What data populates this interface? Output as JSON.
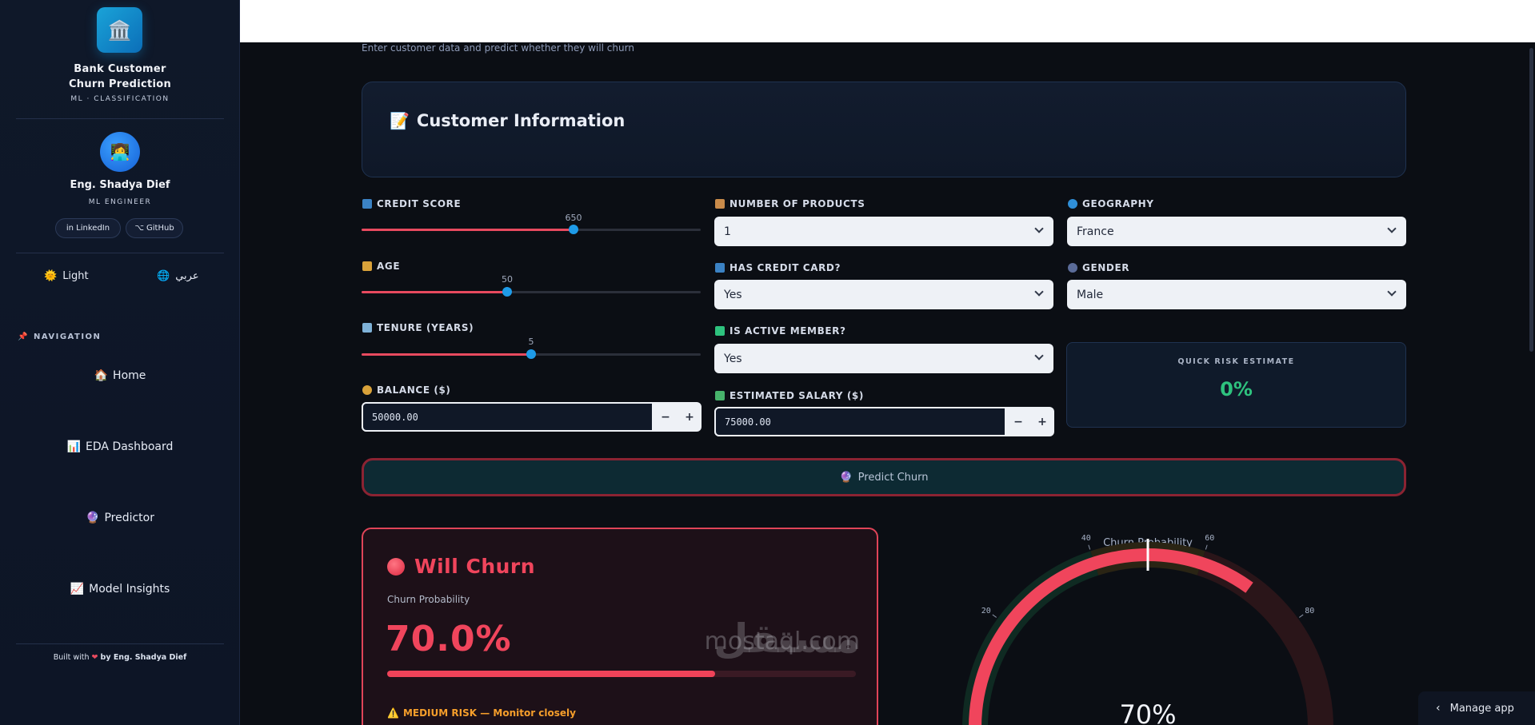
{
  "sidebar": {
    "brand_title_line1": "Bank Customer",
    "brand_title_line2": "Churn Prediction",
    "brand_sub": "ML · CLASSIFICATION",
    "author_name": "Eng. Shadya Dief",
    "author_role": "ML ENGINEER",
    "linkedin_label": "in LinkedIn",
    "github_label": "⌥ GitHub",
    "theme_label": "Light",
    "language_label": "عربي",
    "nav_label": "NAVIGATION",
    "nav_items": [
      {
        "icon": "🏠",
        "label": "Home"
      },
      {
        "icon": "📊",
        "label": "EDA Dashboard"
      },
      {
        "icon": "🔮",
        "label": "Predictor"
      },
      {
        "icon": "📈",
        "label": "Model Insights"
      }
    ],
    "footer_prefix": "Built with",
    "footer_suffix": "by Eng. Shadya Dief"
  },
  "header": {
    "subtitle": "Enter customer data and predict whether they will churn"
  },
  "section": {
    "title": "Customer Information"
  },
  "fields": {
    "credit_score": {
      "label": "CREDIT SCORE",
      "value": "650",
      "fraction": 0.6258
    },
    "age": {
      "label": "AGE",
      "value": "50",
      "fraction": 0.4286
    },
    "tenure": {
      "label": "TENURE (YEARS)",
      "value": "5",
      "fraction": 0.5
    },
    "balance": {
      "label": "BALANCE ($)",
      "value": "50000.00"
    },
    "num_products": {
      "label": "NUMBER OF PRODUCTS",
      "value": "1"
    },
    "has_credit_card": {
      "label": "HAS CREDIT CARD?",
      "value": "Yes"
    },
    "is_active": {
      "label": "IS ACTIVE MEMBER?",
      "value": "Yes"
    },
    "salary": {
      "label": "ESTIMATED SALARY ($)",
      "value": "75000.00"
    },
    "geography": {
      "label": "GEOGRAPHY",
      "value": "France"
    },
    "gender": {
      "label": "GENDER",
      "value": "Male"
    }
  },
  "quick_risk": {
    "title": "QUICK RISK ESTIMATE",
    "value": "0%"
  },
  "predict_button": {
    "icon": "🔮",
    "label": "Predict Churn"
  },
  "result": {
    "title": "Will Churn",
    "sub": "Churn Probability",
    "pct": "70.0%",
    "probability": 0.7,
    "risk_text": "MEDIUM RISK — Monitor closely"
  },
  "gauge": {
    "title": "Churn Probability",
    "value_text": "70%",
    "value": 70,
    "ticks": [
      "20",
      "40",
      "60",
      "80"
    ]
  },
  "watermark": {
    "arabic": "مستقل",
    "latin": "mostaql.com"
  },
  "manage_app": {
    "label": "Manage app"
  },
  "colors": {
    "accent": "#e84a5f",
    "thumb": "#1e9be8",
    "low": "#2ec27e",
    "medium": "#f59e2b"
  }
}
